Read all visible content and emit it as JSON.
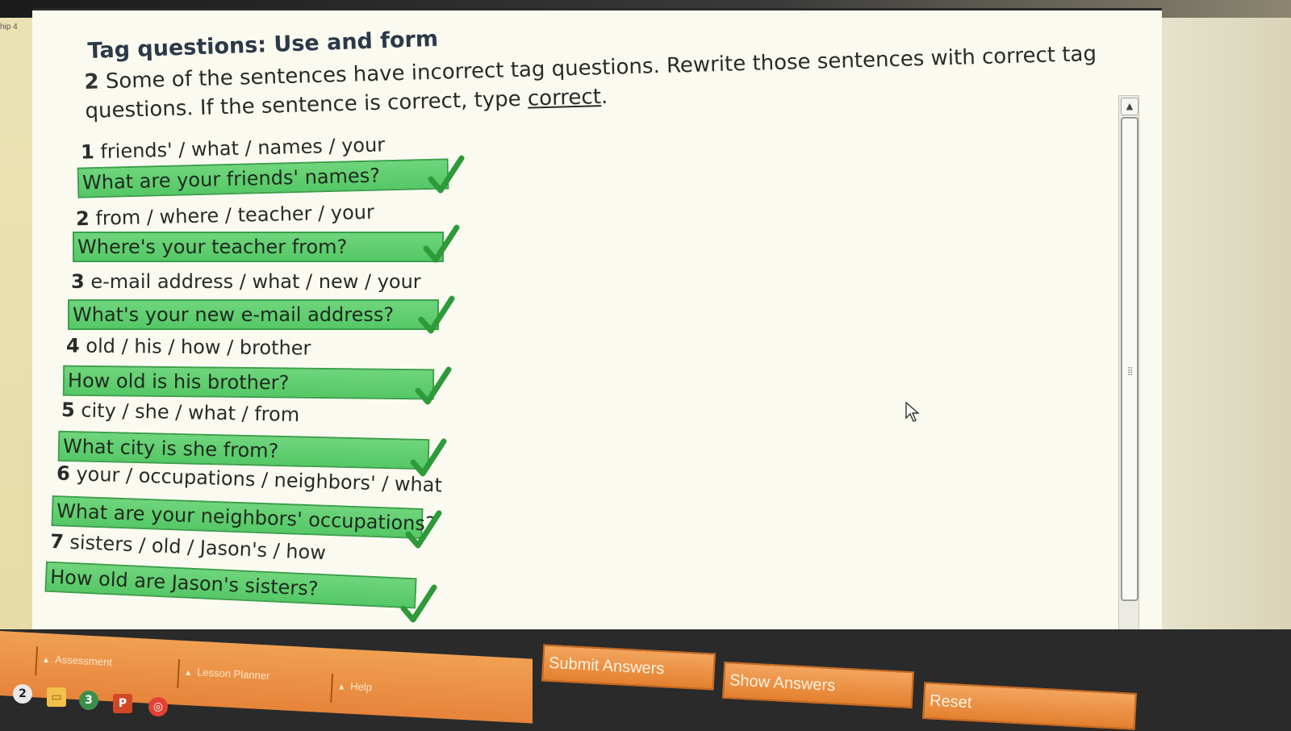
{
  "window": {
    "chapter_label": "hip 4"
  },
  "header": {
    "title": "Tag questions: Use and form",
    "instruction_number": "2",
    "instruction_text_before": "Some of the sentences have incorrect tag questions. Rewrite those sentences with correct tag questions. If the sentence is correct, type ",
    "instruction_keyword": "correct",
    "instruction_end": "."
  },
  "items": [
    {
      "number": "1",
      "prompt": "friends' / what / names / your",
      "answer": "What are your friends' names?",
      "status": "correct"
    },
    {
      "number": "2",
      "prompt": "from / where / teacher / your",
      "answer": "Where's your teacher from?",
      "status": "correct"
    },
    {
      "number": "3",
      "prompt": "e-mail address / what / new / your",
      "answer": "What's your new e-mail address?",
      "status": "correct"
    },
    {
      "number": "4",
      "prompt": "old / his / how / brother",
      "answer": "How old is his brother?",
      "status": "correct"
    },
    {
      "number": "5",
      "prompt": "city / she / what / from",
      "answer": "What city is she from?",
      "status": "correct"
    },
    {
      "number": "6",
      "prompt": "your / occupations / neighbors' / what",
      "answer": "What are your neighbors' occupations?",
      "status": "correct"
    },
    {
      "number": "7",
      "prompt": "sisters / old / Jason's / how",
      "answer": "How old are Jason's sisters?",
      "status": "correct"
    }
  ],
  "bottom_tabs": [
    {
      "label": "Assessment"
    },
    {
      "label": "Lesson Planner"
    },
    {
      "label": "Help"
    }
  ],
  "actions": {
    "submit": "Submit Answers",
    "show": "Show Answers",
    "reset": "Reset"
  },
  "taskbar": {
    "badge_a": "2",
    "badge_b": "3"
  },
  "colors": {
    "correct_fill": "#5fcf70",
    "check_mark": "#2e9a3a",
    "orange_button": "#eb8f3f",
    "title_text": "#2c3947"
  }
}
